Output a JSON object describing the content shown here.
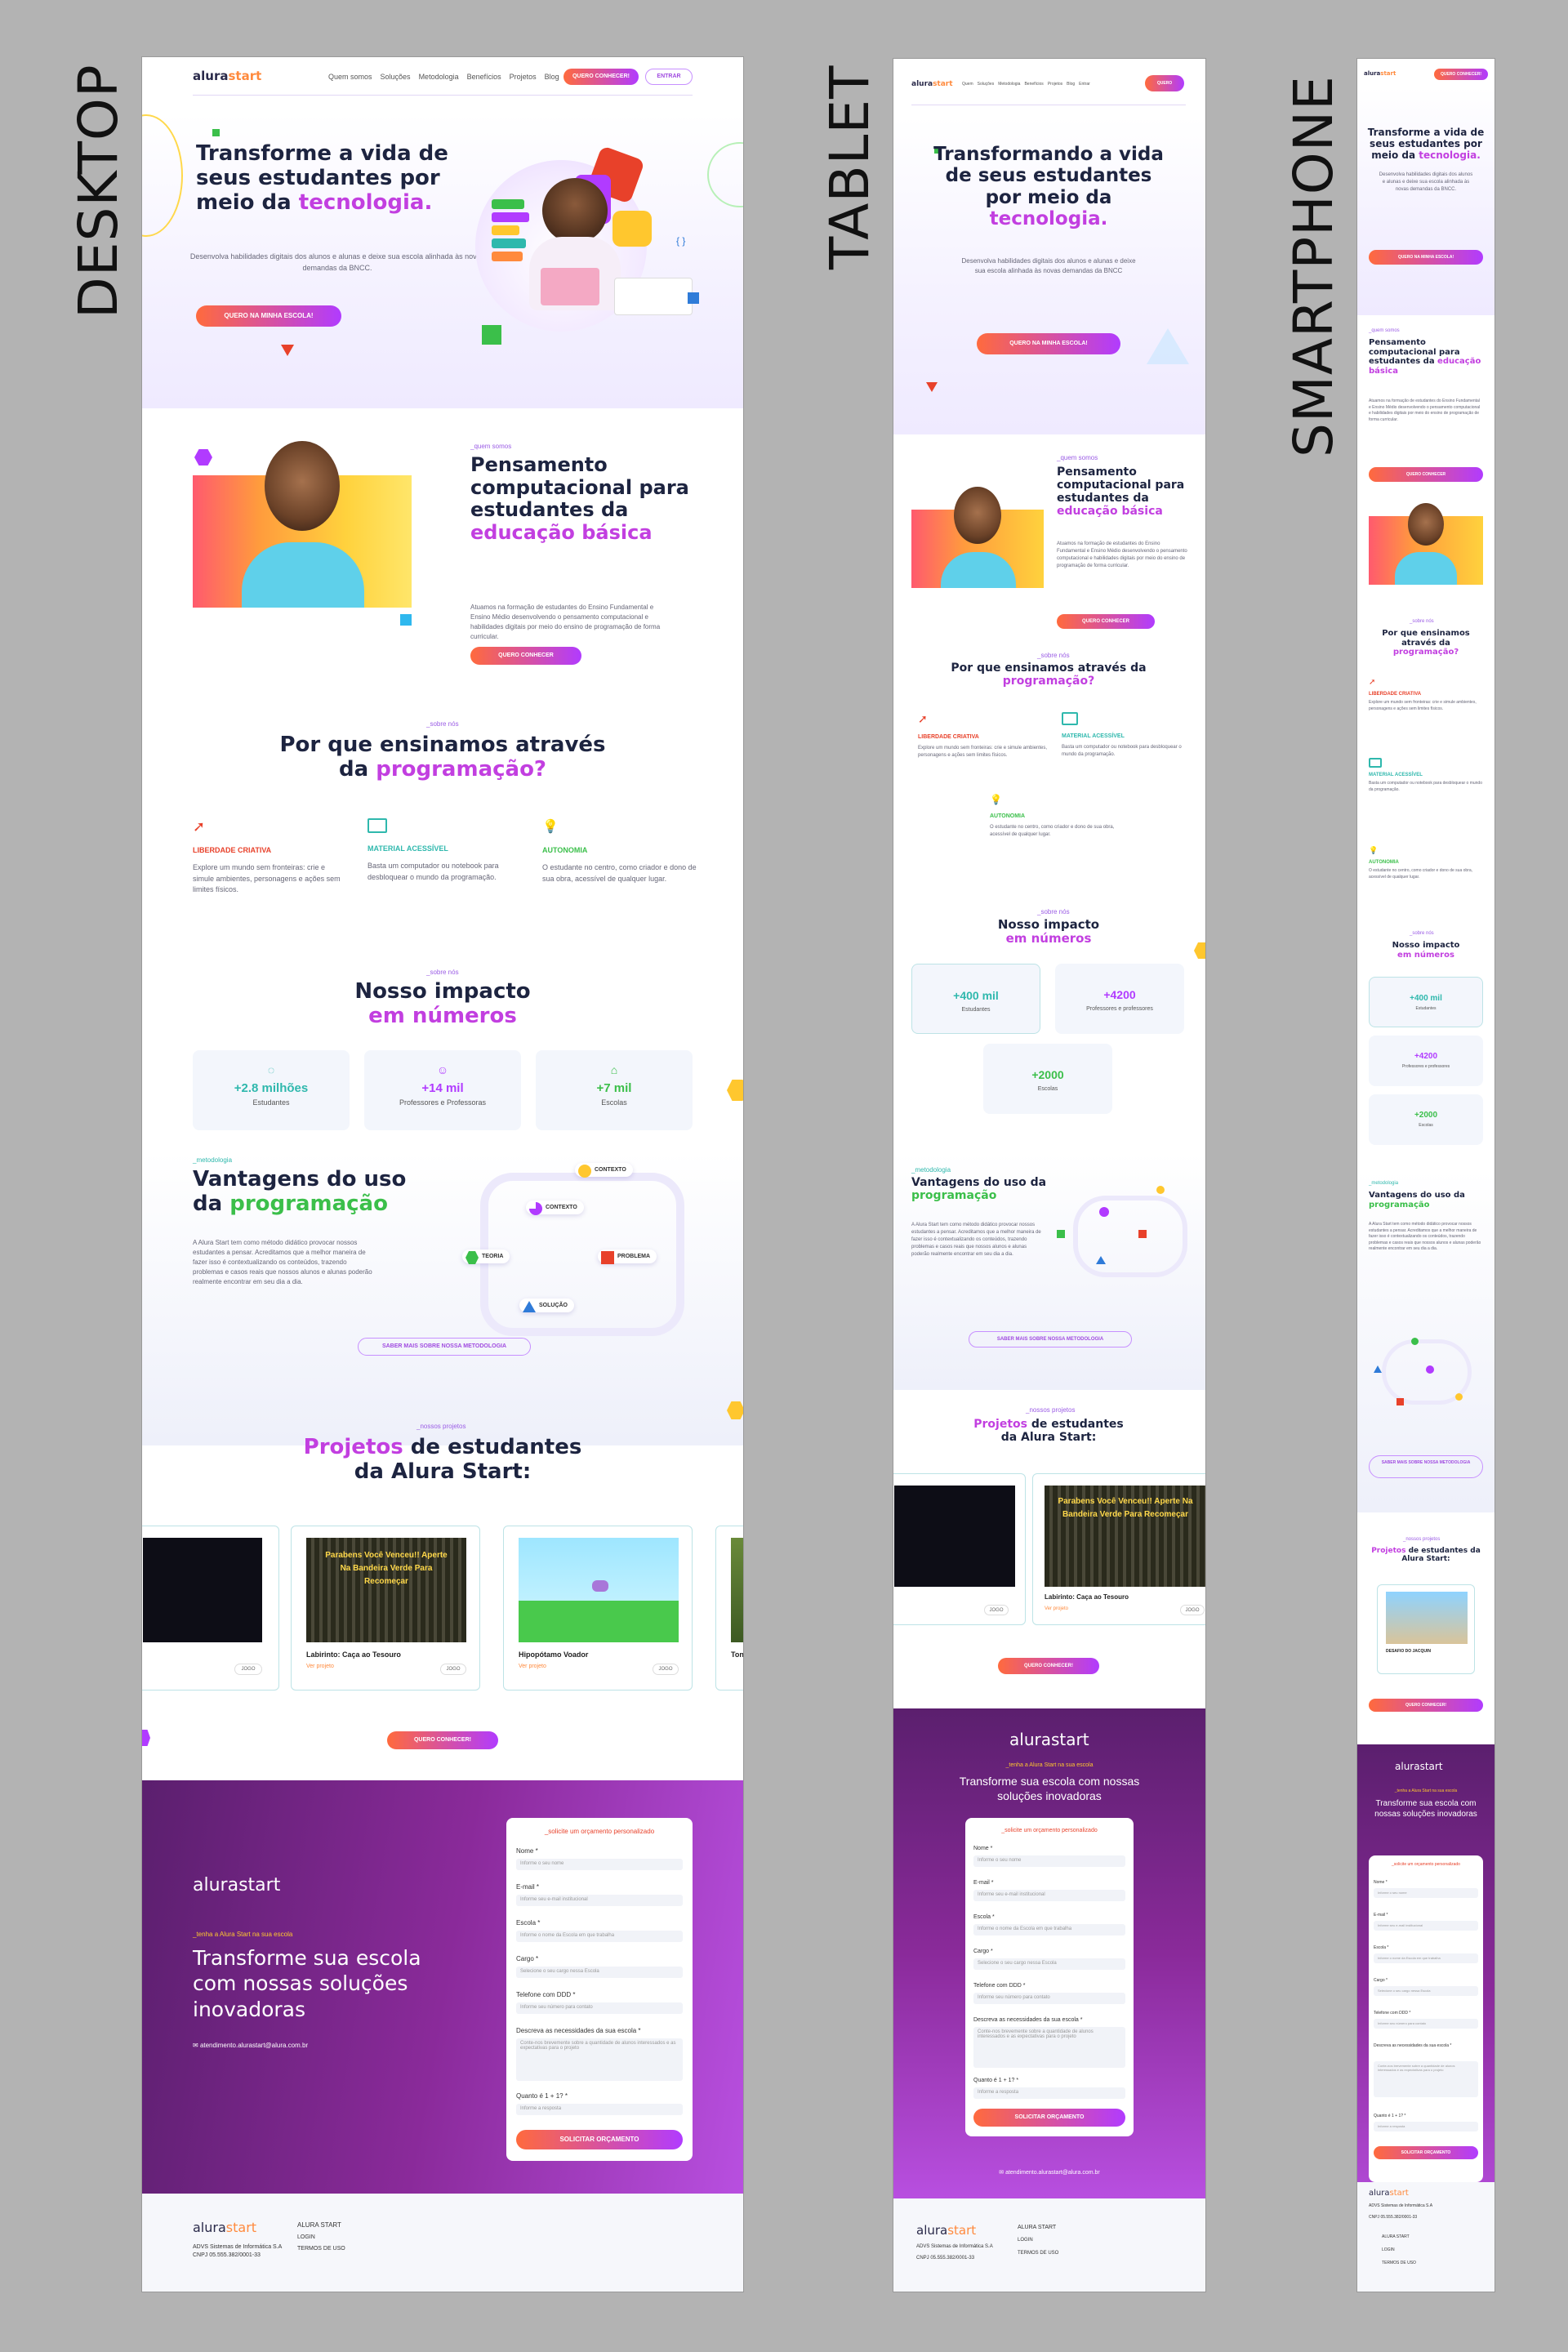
{
  "labels": {
    "desktop": "DESKTOP",
    "tablet": "TABLET",
    "smartphone": "SMARTPHONE"
  },
  "brand": {
    "name_a": "alura",
    "name_b": "start",
    "accent": "#c23fe0",
    "cta_gradient": [
      "#ff6a3d",
      "#b13bff"
    ]
  },
  "nav": {
    "items": [
      "Quem somos",
      "Soluções",
      "Metodologia",
      "Benefícios",
      "Projetos",
      "Blog"
    ],
    "tablet_items": [
      "Quem",
      "Soluções",
      "Metodologia",
      "Benefícios",
      "Projetos",
      "Blog",
      "Entrar"
    ],
    "cta": "QUERO CONHECER!",
    "login": "ENTRAR",
    "tablet_cta": "QUERO CONHECER"
  },
  "hero": {
    "title_a": "Transforme a vida de seus estudantes por meio da ",
    "title_accent": "tecnologia.",
    "tablet_title_a": "Transformando a vida de seus estudantes por meio da ",
    "subtitle": "Desenvolva habilidades digitais dos alunos e alunas e deixe sua escola alinhada às novas demandas da BNCC.",
    "tablet_subtitle": "Desenvolva habilidades digitais dos alunos e alunas e deixe sua escola alinhada às novas demandas da BNCC",
    "cta": "QUERO NA MINHA ESCOLA!"
  },
  "about": {
    "tag": "_quem somos",
    "title_a": "Pensamento computacional para estudantes da ",
    "title_accent": "educação básica",
    "text": "Atuamos na formação de estudantes do Ensino Fundamental e Ensino Médio desenvolvendo o pensamento computacional e habilidades digitais por meio do ensino de programação de forma curricular.",
    "cta": "QUERO CONHECER"
  },
  "why": {
    "tag": "_sobre nós",
    "title_a": "Por que ensinamos através da ",
    "title_accent": "programação?",
    "features": [
      {
        "icon": "rocket-icon",
        "title": "LIBERDADE CRIATIVA",
        "color": "#e8412a",
        "text": "Explore um mundo sem fronteiras: crie e simule ambientes, personagens e ações sem limites físicos."
      },
      {
        "icon": "monitor-icon",
        "title": "MATERIAL ACESSÍVEL",
        "color": "#2fb8ad",
        "text": "Basta um computador ou notebook para desbloquear o mundo da programação."
      },
      {
        "icon": "lightbulb-icon",
        "title": "AUTONOMIA",
        "color": "#3bbf4a",
        "text": "O estudante no centro, como criador e dono de sua obra, acessível de qualquer lugar."
      }
    ]
  },
  "impact": {
    "tag": "_sobre nós",
    "title_a": "Nosso impacto",
    "title_accent": "em números",
    "stats": [
      {
        "icon": "bulb-icon",
        "value": "+2.8 milhões",
        "label": "Estudantes"
      },
      {
        "icon": "teacher-icon",
        "value": "+14 mil",
        "label": "Professores e Professoras"
      },
      {
        "icon": "school-icon",
        "value": "+7 mil",
        "label": "Escolas"
      }
    ],
    "tablet_stats": [
      {
        "value": "+400 mil",
        "label": "Estudantes"
      },
      {
        "value": "+4200",
        "label": "Professores e professores"
      },
      {
        "value": "+2000",
        "label": "Escolas"
      }
    ]
  },
  "method": {
    "tag": "_metodologia",
    "title_a": "Vantagens do uso da ",
    "title_accent": "programação",
    "text": "A Alura Start tem como método didático provocar nossos estudantes a pensar. Acreditamos que a melhor maneira de fazer isso é contextualizando os conteúdos, trazendo problemas e casos reais que nossos alunos e alunas poderão realmente encontrar em seu dia a dia.",
    "nodes": [
      "CONTEXTO",
      "CONTEXTO",
      "TEORIA",
      "PROBLEMA",
      "SOLUÇÃO"
    ],
    "cta": "SABER MAIS SOBRE NOSSA METODOLOGIA"
  },
  "projects": {
    "tag": "_nossos projetos",
    "title_accent": "Projetos",
    "title_b": " de estudantes da Alura Start:",
    "items": [
      {
        "title": "",
        "link": "",
        "badge": "JOGO",
        "game": "dark"
      },
      {
        "title": "Labirinto: Caça ao Tesouro",
        "link": "Ver projeto",
        "badge": "JOGO",
        "game": "maze",
        "overlay": "Parabens Você Venceu!! Aperte Na Bandeira Verde Para Recomeçar"
      },
      {
        "title": "Hipopótamo Voador",
        "link": "Ver projeto",
        "badge": "JOGO",
        "game": "sky"
      },
      {
        "title": "Ton",
        "link": "",
        "badge": "",
        "game": "forest"
      }
    ],
    "mobile_item": "DESAFIO DO JACQUIN",
    "cta": "QUERO CONHECER!"
  },
  "contact": {
    "tag": "_tenha a Alura Start na sua escola",
    "title": "Transforme sua escola com nossas soluções inovadoras",
    "email": "atendimento.alurastart@alura.com.br",
    "form_title": "_solicite um orçamento personalizado",
    "fields": [
      {
        "label": "Nome *",
        "placeholder": "Informe o seu nome"
      },
      {
        "label": "E-mail *",
        "placeholder": "Informe seu e-mail institucional"
      },
      {
        "label": "Escola *",
        "placeholder": "Informe o nome da Escola em que trabalha"
      },
      {
        "label": "Cargo *",
        "placeholder": "Selecione o seu cargo nessa Escola"
      },
      {
        "label": "Telefone com DDD *",
        "placeholder": "Informe seu número para contato"
      },
      {
        "label": "Descreva as necessidades da sua escola *",
        "placeholder": "Conte-nos brevemente sobre a quantidade de alunos interessados e as expectativas para o projeto"
      },
      {
        "label": "Quanto é 1 + 1? *",
        "placeholder": "Informe a resposta"
      }
    ],
    "submit": "SOLICITAR ORÇAMENTO"
  },
  "footer": {
    "company": "ADVS Sistemas de Informática S.A",
    "cnpj": "CNPJ 05.555.382/0001-33",
    "heading": "ALURA START",
    "links": [
      "LOGIN",
      "TERMOS DE USO"
    ]
  }
}
